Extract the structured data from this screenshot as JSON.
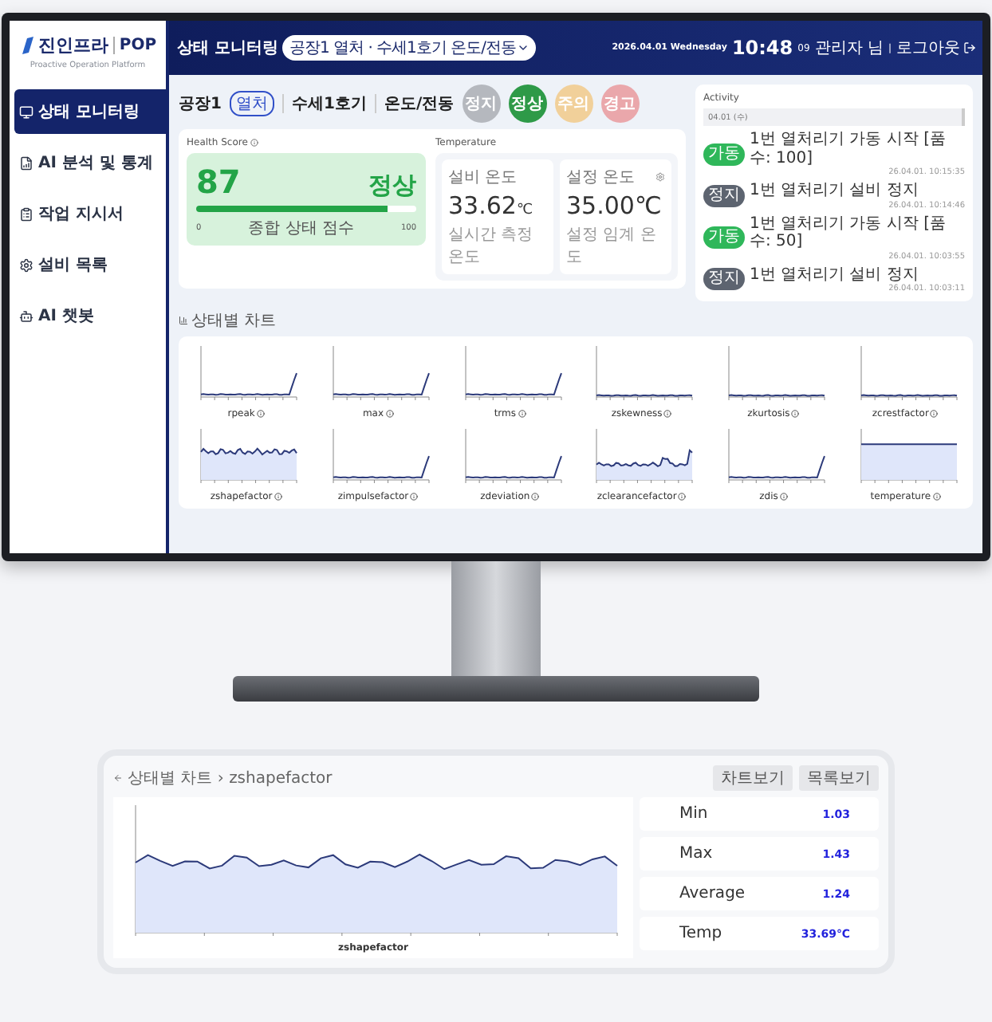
{
  "logo": {
    "brand": "진인프라",
    "product": "POP",
    "tagline": "Proactive Operation Platform"
  },
  "sidebar": {
    "items": [
      {
        "label": "상태 모니터링",
        "selected": true
      },
      {
        "label": "AI 분석 및 통계",
        "selected": false
      },
      {
        "label": "작업 지시서",
        "selected": false
      },
      {
        "label": "설비 목록",
        "selected": false
      },
      {
        "label": "AI 챗봇",
        "selected": false
      }
    ]
  },
  "header": {
    "title": "상태 모니터링",
    "breadcrumb": "공장1 열처 · 수세1호기 온도/전동",
    "date": "2026.04.01 Wednesday",
    "time": "10:48",
    "seconds": "09",
    "user": "관리자 님",
    "separator": "|",
    "logout": "로그아웃"
  },
  "equipment": {
    "factory": "공장1",
    "factory_tag": "열처",
    "line": "수세1호기",
    "sensor": "온도/전동",
    "status_chips": [
      {
        "label": "정지",
        "color": "#b5b8be"
      },
      {
        "label": "정상",
        "color": "#2e9a48"
      },
      {
        "label": "주의",
        "color": "#f1d09a"
      },
      {
        "label": "경고",
        "color": "#eaa7ab"
      }
    ]
  },
  "health": {
    "title": "Health Score",
    "score": "87",
    "status": "정상",
    "level": 0.87,
    "min": "0",
    "caption": "종합 상태 점수",
    "max": "100"
  },
  "temperature": {
    "title": "Temperature",
    "cards": [
      {
        "kind": "live",
        "label": "설비 온도",
        "value": "33.62",
        "unit": "℃",
        "caption": "실시간 측정 온도"
      },
      {
        "kind": "setting",
        "label": "설정 온도",
        "value": "35.00℃",
        "caption": "설정 임계 온도"
      }
    ]
  },
  "activity": {
    "title": "Activity",
    "date": "04.01 (수)",
    "items": [
      {
        "badge": "가동",
        "color": "#2fb75a",
        "text": "1번 열처리기 가동 시작 [품수: 100]",
        "time": "26.04.01. 10:15:35"
      },
      {
        "badge": "정지",
        "color": "#5d6470",
        "text": "1번 열처리기 설비 정지",
        "time": "26.04.01. 10:14:46"
      },
      {
        "badge": "가동",
        "color": "#2fb75a",
        "text": "1번 열처리기 가동 시작 [품수: 50]",
        "time": "26.04.01. 10:03:55"
      },
      {
        "badge": "정지",
        "color": "#5d6470",
        "text": "1번 열처리기 설비 정지",
        "time": "26.04.01. 10:03:11"
      }
    ]
  },
  "charts": {
    "title": "상태별 차트",
    "items": [
      {
        "label": "rpeak",
        "kind": "spike"
      },
      {
        "label": "max",
        "kind": "spike"
      },
      {
        "label": "trms",
        "kind": "spike"
      },
      {
        "label": "zskewness",
        "kind": "flat"
      },
      {
        "label": "zkurtosis",
        "kind": "flat"
      },
      {
        "label": "zcrestfactor",
        "kind": "flat"
      },
      {
        "label": "zshapefactor",
        "kind": "wavy"
      },
      {
        "label": "zimpulsefactor",
        "kind": "spike"
      },
      {
        "label": "zdeviation",
        "kind": "spike"
      },
      {
        "label": "zclearancefactor",
        "kind": "bumpy"
      },
      {
        "label": "zdis",
        "kind": "spike"
      },
      {
        "label": "temperature",
        "kind": "level"
      }
    ]
  },
  "detail": {
    "breadcrumb": "상태별 차트",
    "separator": "›",
    "current": "zshapefactor",
    "buttons": [
      "차트보기",
      "목록보기"
    ],
    "chart_label": "zshapefactor",
    "stats": [
      {
        "label": "Min",
        "value": "1.03"
      },
      {
        "label": "Max",
        "value": "1.43"
      },
      {
        "label": "Average",
        "value": "1.24"
      },
      {
        "label": "Temp",
        "value": "33.69℃"
      }
    ]
  }
}
